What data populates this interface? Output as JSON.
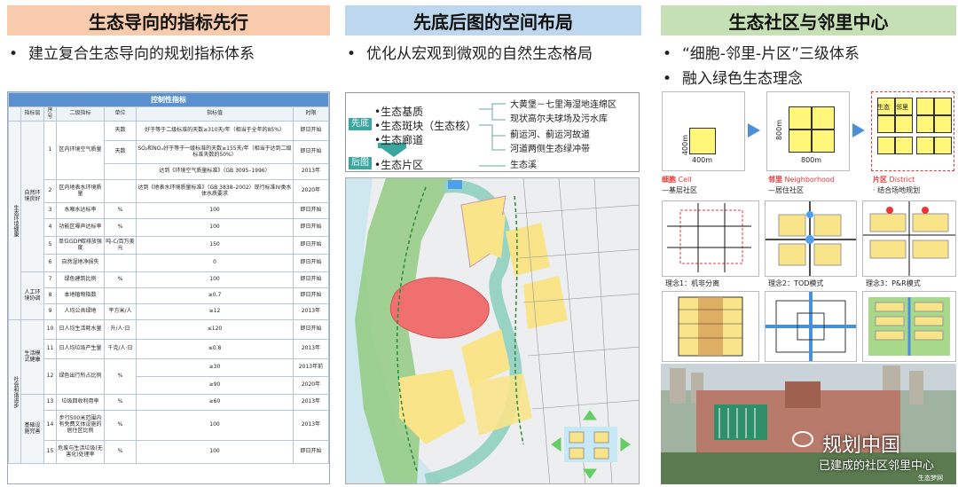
{
  "headers": {
    "h1": "生态导向的指标先行",
    "h2": "先底后图的空间布局",
    "h3": "生态社区与邻里中心"
  },
  "colors": {
    "h1_bg": "#f8cbad",
    "h2_bg": "#bdd7ee",
    "h3_bg": "#c5e0b4"
  },
  "bullets": {
    "b1": "建立复合生态导向的规划指标体系",
    "b2": "优化从宏观到微观的自然生态格局",
    "b3": "“细胞-邻里-片区”三级体系",
    "b4": "融入绿色生态理念"
  },
  "table": {
    "caption": "控制性指标",
    "head": [
      "指标层",
      "序号",
      "二级指标",
      "单位",
      "指标值",
      "时限"
    ],
    "groups": {
      "g1": "生态环境健康",
      "g2": "社会和谐进步"
    },
    "subgroups": {
      "s1": "自然环境良好",
      "s2": "人工环境协调",
      "s3": "生活模式健康",
      "s4": "基础设施完善"
    },
    "rows": [
      {
        "no": "1",
        "name": "区内环境空气质量",
        "unit": "天数",
        "value": "好于等于二级标准的天数≥310天/年（相当于全年的85%）",
        "time": "即日开始"
      },
      {
        "no": "",
        "name": "",
        "unit": "天数",
        "value": "SO₂和NOₓ好于等于一级标准的天数≥155天/年（相当于达到二级标准天数的50%）",
        "time": "即日开始"
      },
      {
        "no": "",
        "name": "",
        "unit": "",
        "value": "达到《环境空气质量标准》（GB 3095–1996）",
        "time": "2013年"
      },
      {
        "no": "2",
        "name": "区内地表水环境质量",
        "unit": "",
        "value": "达到《地表水环境质量标准》（GB 3838–2002）现行标准IV类水体水质要求",
        "time": "2020年"
      },
      {
        "no": "3",
        "name": "水喉水达标率",
        "unit": "%",
        "value": "100",
        "time": "即日开始"
      },
      {
        "no": "4",
        "name": "功能区噪声达标率",
        "unit": "%",
        "value": "100",
        "time": "即日开始"
      },
      {
        "no": "5",
        "name": "单位GDP碳排放强度",
        "unit": "吨-C/百万美元",
        "value": "150",
        "time": "即日开始"
      },
      {
        "no": "6",
        "name": "自然湿地净损失",
        "unit": "",
        "value": "0",
        "time": "即日开始"
      },
      {
        "no": "7",
        "name": "绿色建筑比例",
        "unit": "%",
        "value": "100",
        "time": "即日开始"
      },
      {
        "no": "8",
        "name": "本地植物指数",
        "unit": "",
        "value": "≥0.7",
        "time": "即日开始"
      },
      {
        "no": "9",
        "name": "人均公共绿地",
        "unit": "平方米/人",
        "value": "≥12",
        "time": "2013年"
      },
      {
        "no": "10",
        "name": "日人均生活耗水量",
        "unit": "升/人·日",
        "value": "≤120",
        "time": "即日开始"
      },
      {
        "no": "11",
        "name": "日人均垃圾产生量",
        "unit": "千克/人·日",
        "value": "≤0.8",
        "time": "2013年"
      },
      {
        "no": "12",
        "name": "绿色出行所占比例",
        "unit": "%",
        "value": "≥30",
        "time": "2013年前"
      },
      {
        "no": "",
        "name": "",
        "unit": "",
        "value": "≥90",
        "time": "2020年"
      },
      {
        "no": "13",
        "name": "垃圾回收利用率",
        "unit": "%",
        "value": "≥60",
        "time": "2013年"
      },
      {
        "no": "14",
        "name": "步行500米范围内有免费文体设施的居住区比例",
        "unit": "%",
        "value": "100",
        "time": "2013年"
      },
      {
        "no": "15",
        "name": "危废与生活垃圾(无害化)处理率",
        "unit": "%",
        "value": "100",
        "time": "即日开始"
      }
    ]
  },
  "legend": {
    "tag_before": "先底",
    "tag_after": "后图",
    "items": [
      "•生态基质",
      "•生态斑块（生态核）",
      "•生态廊道",
      "•生态片区"
    ],
    "notes": [
      "大黄堡－七里海湿地连绵区",
      "现状高尔夫球场及污水库",
      "蓟运河、蓟运河故道",
      "河道两侧生态绿冲带",
      "生态溪"
    ]
  },
  "diagrams": {
    "cell_size": "400m",
    "neighborhood_size": "800m",
    "cell_label": "细胞",
    "cell_en": "Cell",
    "cell_desc": "—基层社区",
    "nb_label": "邻里",
    "nb_en": "Neighborhood",
    "nb_desc": "—居住社区",
    "district_label": "片区",
    "district_en": "District",
    "district_desc": "· 结合场地规划",
    "cell_text": "生态",
    "nb_text": "邻里",
    "concept1": "理念1：机非分离",
    "concept2": "理念2：TOD模式",
    "concept3": "理念3：P&R模式"
  },
  "watermark": {
    "title": "规划中国",
    "subtitle": "已建成的社区邻里中心",
    "small": "生态梦网"
  }
}
